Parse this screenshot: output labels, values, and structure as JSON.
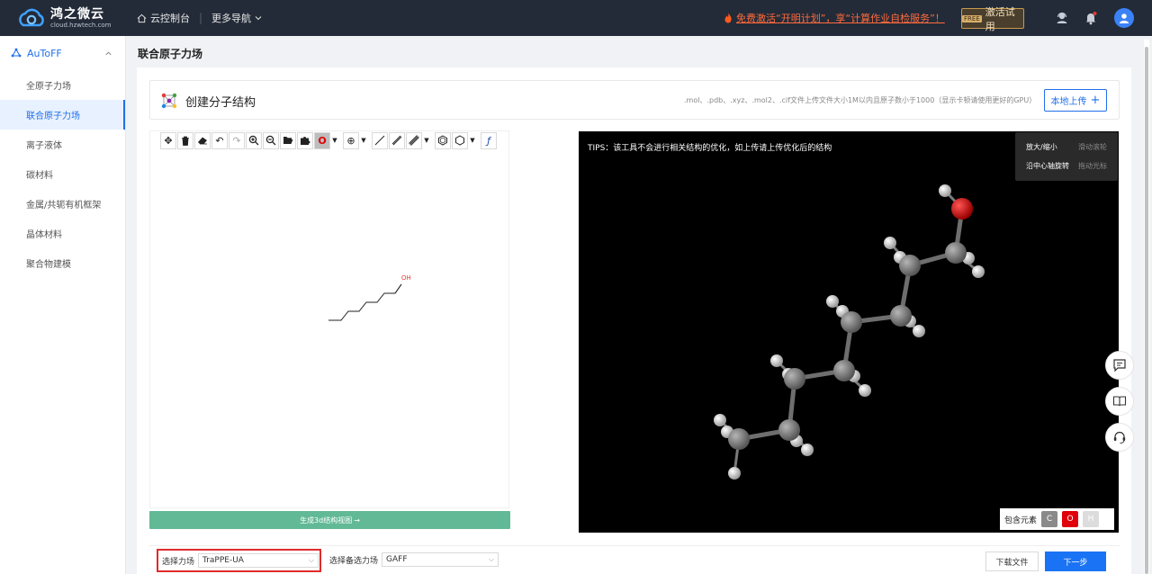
{
  "brand": {
    "name": "鸿之微云",
    "domain": "cloud.hzwtech.com"
  },
  "topnav": {
    "console": "云控制台",
    "more_nav": "更多导航",
    "promo": "免费激活“开明计划”，享“计算作业自检服务”！",
    "trial_tag": "FREE",
    "trial_label": "激活试用"
  },
  "sidebar": {
    "group": "AuToFF",
    "items": [
      {
        "label": "全原子力场"
      },
      {
        "label": "联合原子力场"
      },
      {
        "label": "离子液体"
      },
      {
        "label": "碳材料"
      },
      {
        "label": "金属/共轭有机框架"
      },
      {
        "label": "晶体材料"
      },
      {
        "label": "聚合物建模"
      }
    ],
    "active_index": 1
  },
  "page": {
    "title": "联合原子力场",
    "section_title": "创建分子结构",
    "upload_note": ".mol、.pdb、.xyz、.mol2、.cif文件上传文件大小1M以内且原子数小于1000（显示卡顿请使用更好的GPU）",
    "upload_label": "本地上传"
  },
  "editor": {
    "tools": [
      "move-icon",
      "trash-icon",
      "eraser-icon",
      "undo-icon",
      "redo-icon",
      "zoom-in-icon",
      "zoom-out-icon",
      "open-icon",
      "puzzle-icon",
      "atom-O",
      "charge-icon",
      "single-bond-icon",
      "double-bond-icon",
      "triple-bond-icon",
      "benzene-icon",
      "hexagon-icon",
      "function-icon"
    ],
    "selected_atom": "O",
    "oh_label": "OH",
    "generate_label": "生成3d结构视图"
  },
  "viewer": {
    "tips": "TIPS：该工具不会进行相关结构的优化，如上传请上传优化后的结构",
    "help": [
      {
        "action": "放大/缩小",
        "how": "滑动滚轮"
      },
      {
        "action": "沿中心轴旋转",
        "how": "拖动光标"
      }
    ],
    "legend_label": "包含元素",
    "elements": [
      {
        "symbol": "C",
        "color": "#8a8a8a"
      },
      {
        "symbol": "O",
        "color": "#e0000b"
      },
      {
        "symbol": "H",
        "color": "#dcdcdc"
      }
    ]
  },
  "bottom": {
    "forcefield_label": "选择力场",
    "forcefield_value": "TraPPE-UA",
    "alt_forcefield_label": "选择备选力场",
    "alt_forcefield_value": "GAFF",
    "download_label": "下载文件",
    "next_label": "下一步"
  }
}
